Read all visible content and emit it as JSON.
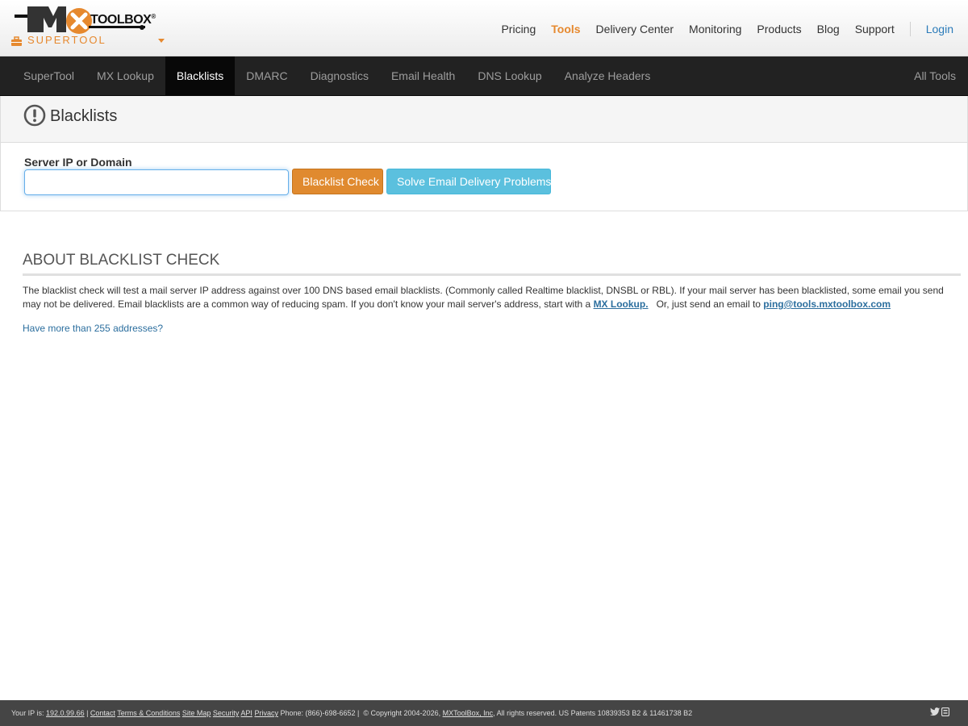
{
  "header": {
    "logo_word": "TOOLBOX",
    "logo_reg": "®",
    "supertool_label": "SUPERTOOL",
    "nav": [
      {
        "label": "Pricing"
      },
      {
        "label": "Tools"
      },
      {
        "label": "Delivery Center"
      },
      {
        "label": "Monitoring"
      },
      {
        "label": "Products"
      },
      {
        "label": "Blog"
      },
      {
        "label": "Support"
      }
    ],
    "login": "Login",
    "active_color": "#e6892f"
  },
  "toolbar": {
    "tabs": [
      {
        "label": "SuperTool"
      },
      {
        "label": "MX Lookup"
      },
      {
        "label": "Blacklists"
      },
      {
        "label": "DMARC"
      },
      {
        "label": "Diagnostics"
      },
      {
        "label": "Email Health"
      },
      {
        "label": "DNS Lookup"
      },
      {
        "label": "Analyze Headers"
      }
    ],
    "active_tab": "Blacklists",
    "all_tools": "All Tools"
  },
  "panel": {
    "title": "Blacklists",
    "icon": "exclamation-circle-icon",
    "field_label": "Server IP or Domain",
    "input_value": "",
    "check_button": "Blacklist Check",
    "solve_button": "Solve Email Delivery Problems"
  },
  "about": {
    "title": "ABOUT BLACKLIST CHECK",
    "text_1": "The blacklist check will test a mail server IP address against over 100 DNS based email blacklists. (Commonly called Realtime blacklist, DNSBL or RBL).  If your mail server has been blacklisted, some email you send may not be delivered.  Email blacklists are a common way of reducing spam.  If you don't know your mail server's address, start with a ",
    "mx_link": "MX Lookup.",
    "text_2": "   Or, just send an email to ",
    "email_link": "ping@tools.mxtoolbox.com",
    "more_link": "Have more than 255 addresses?"
  },
  "footer": {
    "ip_label": "Your IP is: ",
    "ip": "192.0.99.66",
    "pipe": " | ",
    "contact": "Contact",
    "terms": "Terms & Conditions",
    "sitemap": "Site Map",
    "security": "Security",
    "api": "API",
    "privacy": "Privacy",
    "phone": " Phone: (866)-698-6652 | ",
    "copyright": " © Copyright 2004-2026, ",
    "company": "MXToolBox, Inc",
    "rights": ", All rights reserved. US Patents 10839353 B2 & 11461738 B2"
  }
}
